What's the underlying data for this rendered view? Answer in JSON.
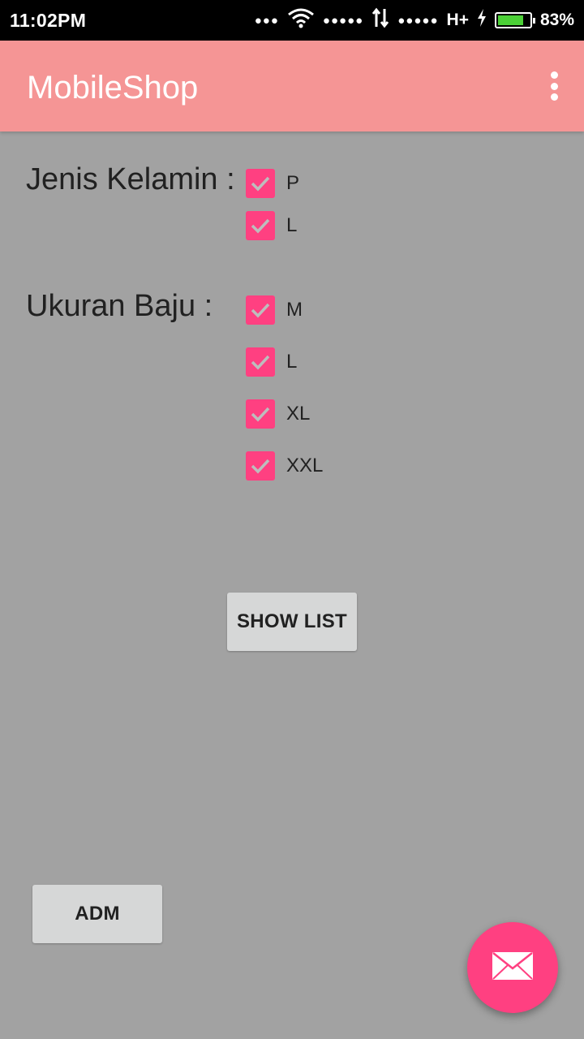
{
  "status_bar": {
    "time": "11:02PM",
    "network": "H+",
    "battery_level": 0.83,
    "battery_text": "83%",
    "icons": [
      "more-dots-icon",
      "wifi-icon",
      "signal-dots-icon",
      "data-arrows-icon",
      "signal-dots-icon",
      "charging-icon",
      "battery-icon"
    ]
  },
  "appbar": {
    "title": "MobileShop",
    "menu_icon": "overflow-menu-icon"
  },
  "gender": {
    "label": "Jenis Kelamin :",
    "options": [
      {
        "label": "P",
        "checked": true
      },
      {
        "label": "L",
        "checked": true
      }
    ]
  },
  "size": {
    "label": "Ukuran Baju :",
    "options": [
      {
        "label": "M",
        "checked": true
      },
      {
        "label": "L",
        "checked": true
      },
      {
        "label": "XL",
        "checked": true
      },
      {
        "label": "XXL",
        "checked": true
      }
    ]
  },
  "buttons": {
    "show_list": "SHOW LIST",
    "adm": "ADM"
  },
  "fab": {
    "icon": "mail-icon"
  },
  "colors": {
    "appbar": "#f59595",
    "accent": "#ff4081",
    "background": "#a2a2a2",
    "button": "#d6d7d7"
  }
}
